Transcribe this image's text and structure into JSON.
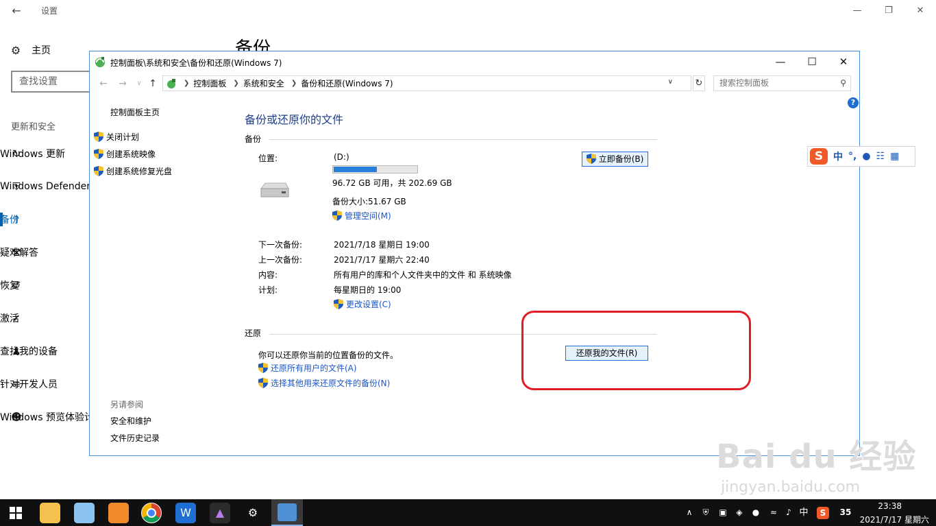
{
  "settings": {
    "title": "设置",
    "home": "主页",
    "search_placeholder": "查找设置",
    "section": "更新和安全",
    "nav": [
      "Windows 更新",
      "Windows Defender",
      "备份",
      "疑难解答",
      "恢复",
      "激活",
      "查找我的设备",
      "针对开发人员",
      "Windows 预览体验计划"
    ],
    "active_index": 2,
    "page_title": "备份"
  },
  "window": {
    "title": "控制面板\\系统和安全\\备份和还原(Windows 7)",
    "breadcrumbs": [
      "控制面板",
      "系统和安全",
      "备份和还原(Windows 7)"
    ],
    "search_placeholder": "搜索控制面板",
    "left": {
      "home": "控制面板主页",
      "tasks": [
        "关闭计划",
        "创建系统映像",
        "创建系统修复光盘"
      ],
      "see_also": "另请参阅",
      "links": [
        "安全和维护",
        "文件历史记录"
      ]
    },
    "main": {
      "title": "备份或还原你的文件",
      "backup": {
        "header": "备份",
        "location_label": "位置:",
        "location_value": "(D:)",
        "used_fraction": 0.52,
        "free_text": "96.72 GB 可用，共 202.69 GB",
        "size_text": "备份大小:51.67 GB",
        "manage_link": "管理空间(M)",
        "backup_now_button": "立即备份(B)",
        "next_label": "下一次备份:",
        "next_value": "2021/7/18 星期日 19:00",
        "last_label": "上一次备份:",
        "last_value": "2021/7/17 星期六 22:40",
        "content_label": "内容:",
        "content_value": "所有用户的库和个人文件夹中的文件 和 系统映像",
        "schedule_label": "计划:",
        "schedule_value": "每星期日的 19:00",
        "change_link": "更改设置(C)"
      },
      "restore": {
        "header": "还原",
        "description": "你可以还原你当前的位置备份的文件。",
        "restore_button": "还原我的文件(R)",
        "all_users_link": "还原所有用户的文件(A)",
        "other_link": "选择其他用来还原文件的备份(N)"
      }
    }
  },
  "ime": {
    "logo": "S",
    "mode": "中",
    "punct": "°,"
  },
  "watermark": {
    "brand": "Bai du 经验",
    "url": "jingyan.baidu.com"
  },
  "taskbar": {
    "lang": "中",
    "badge": "35",
    "time": "23:38",
    "date": "2021/7/17 星期六"
  },
  "colors": {
    "accent": "#0063b1",
    "link": "#1a56c8",
    "title_blue": "#1e3e8a",
    "highlight": "#e21c24"
  }
}
